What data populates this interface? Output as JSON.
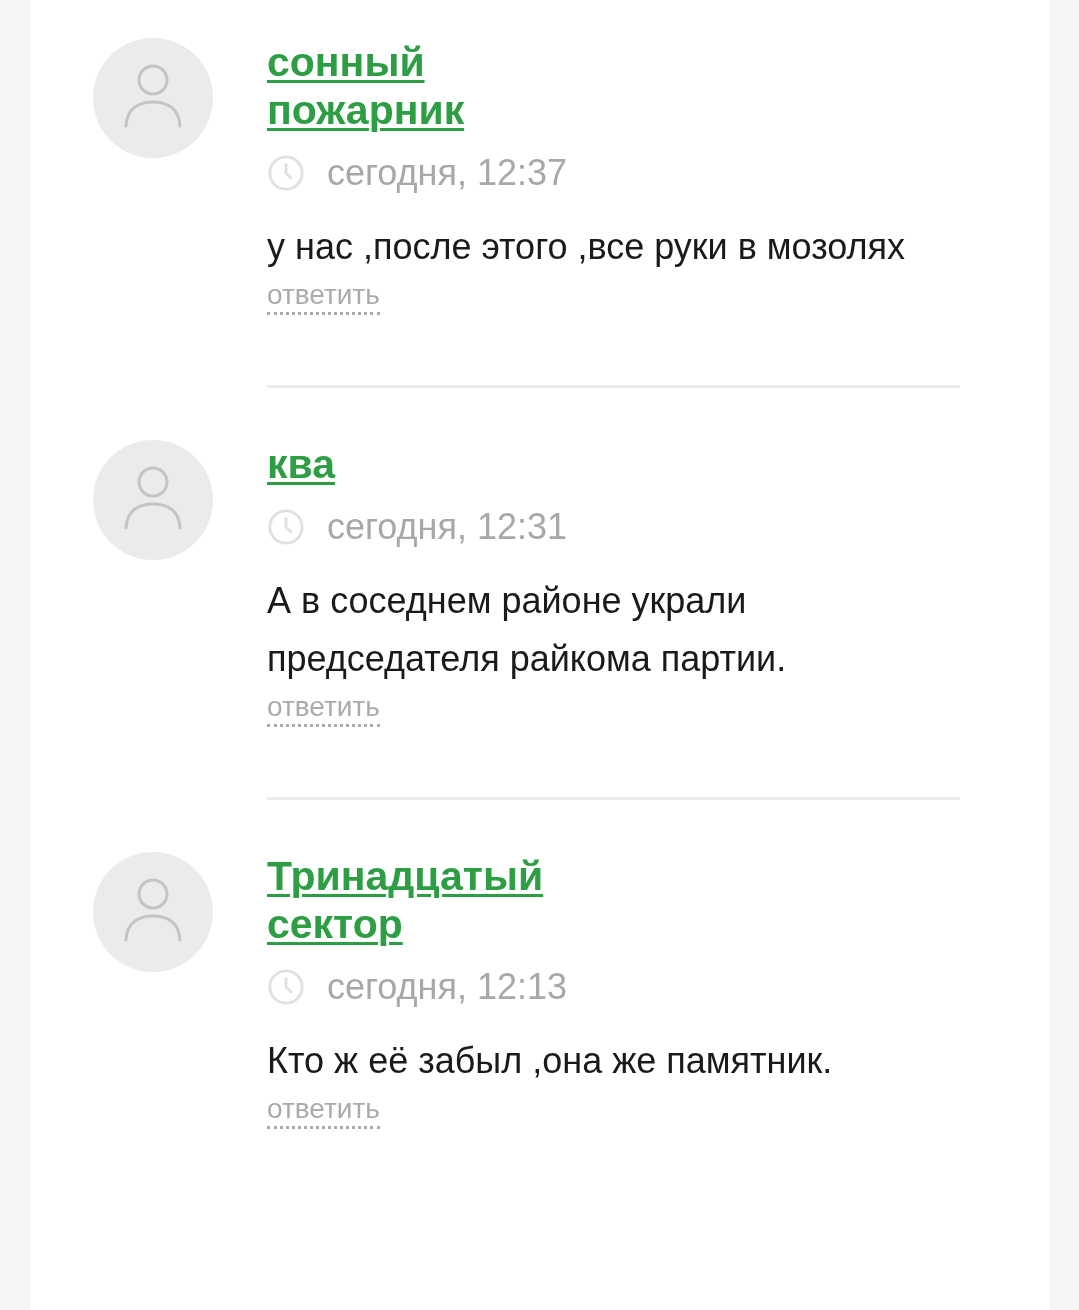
{
  "comments": [
    {
      "author": "сонный пожарник",
      "time": "сегодня, 12:37",
      "text": "у нас ,после этого ,все руки в мозолях",
      "reply": "ответить"
    },
    {
      "author": "ква",
      "time": "сегодня, 12:31",
      "text": "А в соседнем районе украли председателя райкома партии.",
      "reply": "ответить"
    },
    {
      "author": "Тринадцатый сектор",
      "time": "сегодня, 12:13",
      "text": "Кто ж её забыл ,она же памятник.",
      "reply": "ответить"
    }
  ]
}
